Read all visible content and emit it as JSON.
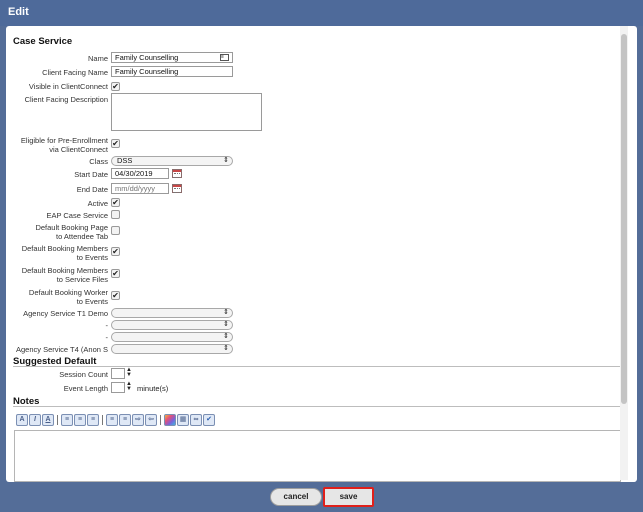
{
  "window": {
    "title": "Edit"
  },
  "case_service": {
    "section_title": "Case Service",
    "name_label": "Name",
    "name_value": "Family Counselling",
    "client_facing_name_label": "Client Facing Name",
    "client_facing_name_value": "Family Counselling",
    "visible_label": "Visible in ClientConnect",
    "visible_checked": true,
    "description_label": "Client Facing Description",
    "description_value": "",
    "eligible_label_line1": "Eligible for Pre-Enrollment",
    "eligible_label_line2": "via ClientConnect",
    "eligible_checked": true,
    "class_label": "Class",
    "class_value": "DSS",
    "start_date_label": "Start Date",
    "start_date_value": "04/30/2019",
    "end_date_label": "End Date",
    "end_date_placeholder": "mm/dd/yyyy",
    "active_label": "Active",
    "active_checked": true,
    "eap_label": "EAP Case Service",
    "eap_checked": false,
    "booking_page_label_line1": "Default Booking Page",
    "booking_page_label_line2": "to Attendee Tab",
    "booking_page_checked": false,
    "booking_members_events_line1": "Default Booking Members",
    "booking_members_events_line2": "to Events",
    "booking_members_events_checked": true,
    "booking_members_files_line1": "Default Booking Members",
    "booking_members_files_line2": "to Service Files",
    "booking_members_files_checked": true,
    "booking_worker_line1": "Default Booking Worker",
    "booking_worker_line2": "to Events",
    "booking_worker_checked": true,
    "agency_t1_label": "Agency Service T1 Demo",
    "agency_t2_label": "-",
    "agency_t3_label": "-",
    "agency_t4_label": "Agency Service T4 (Anon S"
  },
  "suggested_default": {
    "section_title": "Suggested Default",
    "session_count_label": "Session Count",
    "event_length_label": "Event Length",
    "event_length_unit": "minute(s)"
  },
  "notes": {
    "section_title": "Notes",
    "toolbar": [
      "bold",
      "italic",
      "underline",
      "align-left",
      "align-center",
      "align-right",
      "bullet-list",
      "numbered-list",
      "indent",
      "outdent",
      "color-picker",
      "table",
      "link",
      "spellcheck"
    ]
  },
  "footer": {
    "cancel_label": "cancel",
    "save_label": "save"
  },
  "colors": {
    "title_bar": "#4e6a9a",
    "background": "#546d98",
    "save_highlight": "#e0201b"
  }
}
